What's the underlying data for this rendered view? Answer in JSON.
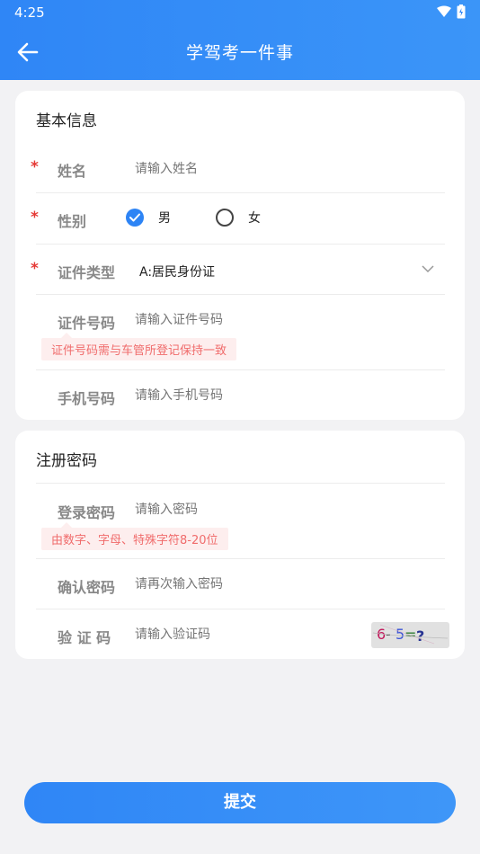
{
  "status_bar": {
    "time": "4:25",
    "icons": [
      "wifi-icon",
      "battery-icon"
    ]
  },
  "header": {
    "title": "学驾考一件事",
    "back_icon": "back-arrow-icon"
  },
  "basic_info": {
    "section_title": "基本信息",
    "name": {
      "required": "*",
      "label": "姓名",
      "placeholder": "请输入姓名"
    },
    "gender": {
      "required": "*",
      "label": "性别",
      "options": [
        {
          "label": "男",
          "selected": true
        },
        {
          "label": "女",
          "selected": false
        }
      ]
    },
    "id_type": {
      "required": "*",
      "label": "证件类型",
      "value": "A:居民身份证"
    },
    "id_number": {
      "label": "证件号码",
      "placeholder": "请输入证件号码",
      "hint": "证件号码需与车管所登记保持一致"
    },
    "phone": {
      "label": "手机号码",
      "placeholder": "请输入手机号码"
    }
  },
  "register_password": {
    "section_title": "注册密码",
    "password": {
      "label": "登录密码",
      "placeholder": "请输入密码",
      "hint": "由数字、字母、特殊字符8-20位"
    },
    "confirm_password": {
      "label": "确认密码",
      "placeholder": "请再次输入密码"
    },
    "captcha": {
      "label": "验 证 码",
      "placeholder": "请输入验证码",
      "image_text": [
        "6",
        "-",
        "5",
        "=",
        "?"
      ]
    }
  },
  "submit_label": "提交",
  "colors": {
    "primary": "#2f86f6",
    "required": "#e53935",
    "hint_bg": "#fdeeee",
    "hint_text": "#f06c6c"
  }
}
